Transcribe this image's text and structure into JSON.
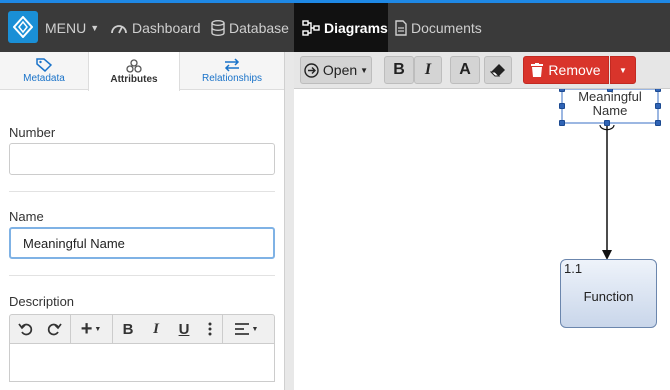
{
  "nav": {
    "menu_label": "MENU",
    "items": [
      {
        "label": "Dashboard",
        "icon": "dashboard-icon"
      },
      {
        "label": "Database",
        "icon": "database-icon"
      },
      {
        "label": "Diagrams",
        "icon": "diagram-icon",
        "active": true
      },
      {
        "label": "Documents",
        "icon": "document-icon"
      }
    ]
  },
  "left_tabs": [
    {
      "label": "Metadata",
      "icon": "tag-icon"
    },
    {
      "label": "Attributes",
      "icon": "attributes-icon",
      "active": true
    },
    {
      "label": "Relationships",
      "icon": "swap-icon"
    }
  ],
  "form": {
    "number_label": "Number",
    "number_value": "",
    "name_label": "Name",
    "name_value": "Meaningful Name",
    "description_label": "Description"
  },
  "rte_toolbar": {
    "undo_icon": "undo-icon",
    "redo_icon": "redo-icon",
    "insert_icon": "plus-icon",
    "bold": "B",
    "italic": "I",
    "underline": "U",
    "more_icon": "more-vertical-icon",
    "align_icon": "align-left-icon"
  },
  "diagram_toolbar": {
    "open_label": "Open",
    "bold": "B",
    "italic": "I",
    "font_glyph": "A",
    "remove_label": "Remove",
    "colors": {
      "remove": "#d9342b"
    }
  },
  "diagram": {
    "selected_node_text_line1": "Meaningful",
    "selected_node_text_line2": "Name",
    "function_node_number": "1.1",
    "function_node_label": "Function"
  },
  "colors": {
    "accent": "#1a8fd6",
    "topbar": "#3a3a3a"
  }
}
